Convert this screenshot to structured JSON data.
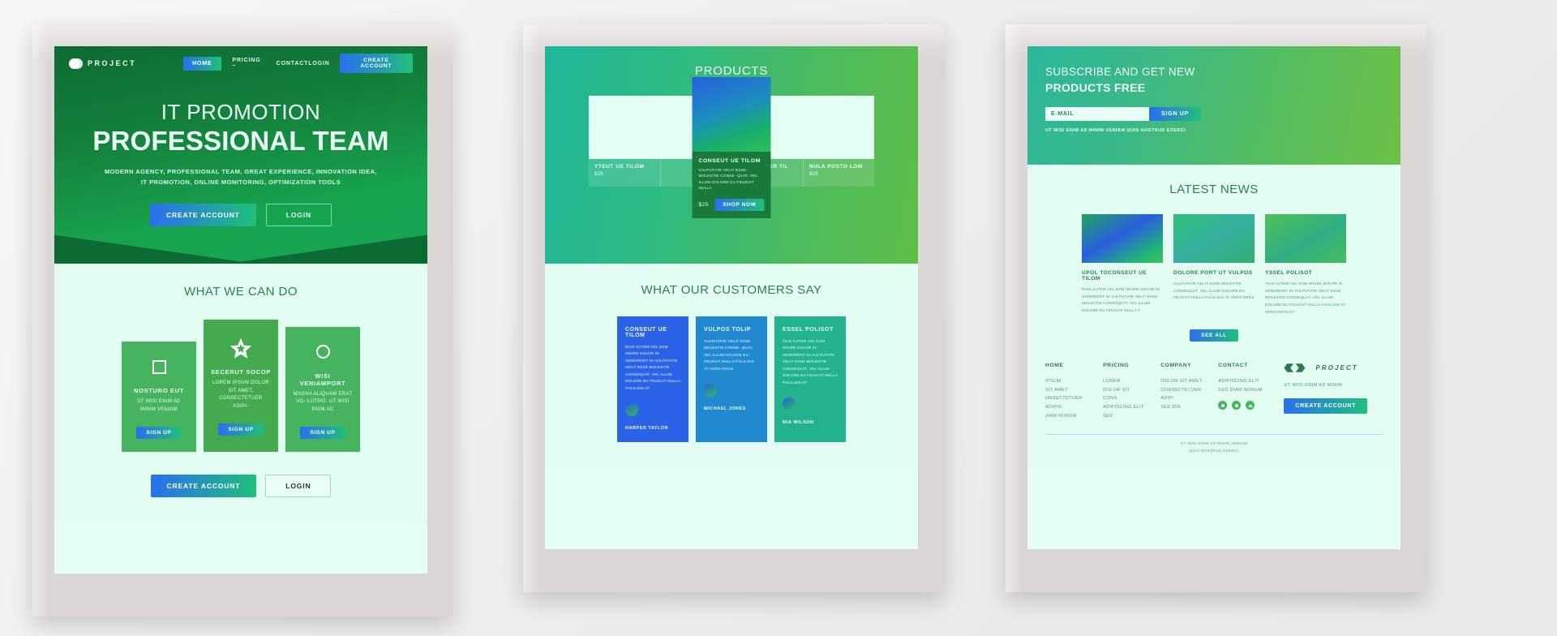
{
  "panel1": {
    "nav": {
      "brand": "PROJECT",
      "links": [
        {
          "label": "HOME",
          "active": true
        },
        {
          "label": "PRICING ~",
          "active": false
        },
        {
          "label": "CONTACT",
          "active": false
        }
      ],
      "login": "LOGIN",
      "create_account": "CREATE ACCOUNT"
    },
    "hero": {
      "eyebrow": "IT PROMOTION",
      "title": "PROFESSIONAL TEAM",
      "desc_line1": "MODERN AGENCY, PROFESSIONAL TEAM, GREAT EXPERIENCE, INNOVATION IDEA,",
      "desc_line2": "IT PROMOTION, ONLINE MONITORING, OPTIMIZATION TOOLS",
      "cta_primary": "CREATE ACCOUNT",
      "cta_secondary": "LOGIN"
    },
    "services": {
      "title": "WHAT WE CAN DO",
      "cards": [
        {
          "icon": "square-icon",
          "title": "NOSTURO EUT",
          "text": "UT WISI ENIM AD MINIM VENIAM",
          "button": "SIGN UP"
        },
        {
          "icon": "star-icon",
          "title": "SECERUT SOCOP",
          "text": "LOREM IPSUM DOLOR SIT AMET, CONSECTETUER ADIPI-",
          "button": "SIGN UP"
        },
        {
          "icon": "circle-icon",
          "title": "WISI VENIAMPORT",
          "text": "MAGNA ALIQUAM ERAT VO- LUTPAT. UT WISI ENIM AD",
          "button": "SIGN UP"
        }
      ],
      "cta_primary": "CREATE ACCOUNT",
      "cta_secondary": "LOGIN"
    }
  },
  "panel2": {
    "products": {
      "title": "PRODUCTS",
      "items": [
        {
          "title": "YTEUT UE TILOM",
          "price": "$25"
        },
        {
          "title": "MOSEUT UER TIL OM",
          "price": "$25"
        },
        {
          "title": "NULA POSTO LOM",
          "price": "$25"
        }
      ],
      "featured": {
        "title": "CONSEUT UE TILOM",
        "text": "VULPUTATE VELIT ESSE MOLESTIE CONSE- QUAT, VEL ILLUM DOLORE EU FEUGIAT NULLA",
        "price": "$25",
        "button": "SHOP NOW"
      }
    },
    "testimonials": {
      "title": "WHAT OUR CUSTOMERS SAY",
      "cards": [
        {
          "title": "CONSEUT UE TILOM",
          "text": "DUIS AUTEM VEL EUM IRIURE DOLOR IN HENDRERIT IN VULPUTATE VELIT ESSE MOLESTIE CONSEQUAT, VEL ILLUM DOLORE EU FEUGIAT NULLA FACILISIS AT",
          "name": "HARPER TAYLOR"
        },
        {
          "title": "VULPOS TOLIP",
          "text": "VULPUTATE VELIT ESSE MOLESTIE CONSE- QUAT, VEL ILLUM DOLORE EU FEUGIAT NULLA FACILISIS AT VERO EROS",
          "name": "MICHAEL JONES"
        },
        {
          "title": "ESSEL POLISOT",
          "text": "TUIS AUTEM VEL EUM IRIURE DOLOR IN HENDRERIT IN VULPUTATE VELIT ESSE MOLESTIE CONSEQUAT, VEL ILLUM DOLORE EU FEUGIAT NULLA FACILISIS AT",
          "name": "MIA WILSON"
        }
      ]
    }
  },
  "panel3": {
    "subscribe": {
      "line1": "SUBSCRIBE AND GET NEW",
      "line2": "PRODUCTS FREE",
      "email_placeholder": "E-MAIL",
      "button": "SIGN UP",
      "note": "UT WISI ENIM AD MINIM VENIAM QUIS NOSTRUD EXERCI"
    },
    "news": {
      "title": "LATEST NEWS",
      "items": [
        {
          "title": "UPOL TOCONSEUT UE TILOM",
          "text": "DUIS AUTEM VEL EUM IRIURE DOLOR IN HENDRERIT IN VULPUTATE VELIT ESSE MOLESTIE CONSEQUAT, VEL ILLUM DOLORE EU FEUGIAT NULLA F"
        },
        {
          "title": "DOLORE PORT UT VULPOS",
          "text": "VULPUTATE VELIT ESSE MOLESTIE CONSEQUAT, VEL ILLUM DOLORE EU FEUGIAT NULLA FACILISIS AT VERO EROS"
        },
        {
          "title": "YSSEL POLISOT",
          "text": "TUIS AUTEM VEL EUM IRIURE DOLOR IN HENDRERIT IN VULPUTATE VELIT ESSE MOLESTIE CONSEQUAT, VEL ILLUM DOLORE EU FEUGIAT NULLA FACILISIS AT VERO EROS ET"
        }
      ],
      "see_all": "SEE ALL"
    },
    "footer": {
      "columns": [
        {
          "heading": "HOME",
          "items": [
            "IPSUM",
            "SIT AMET",
            "HNSECTETUER",
            "ADIPIS",
            "JIAM NONUM"
          ]
        },
        {
          "heading": "PRICING",
          "items": [
            "LOREM",
            "DOLOR SIT",
            "CONS",
            "ADIPISCING ELIT",
            "SED"
          ]
        },
        {
          "heading": "COMPANY",
          "items": [
            "DOLOR SIT AMET",
            "CONSECTETUER",
            "ADIPI",
            "SED DIA"
          ]
        },
        {
          "heading": "CONTACT",
          "items": [
            "ADIPISCING ELIT",
            "SED DIAM NONUM"
          ]
        }
      ],
      "brand": "PROJECT",
      "brand_note": "UT WISI ENIM AD MINIM",
      "cta": "CREATE ACCOUNT",
      "legal_line1": "UT WISI ENIM AD MINIM VENIAM",
      "legal_line2": "QUIS NOSTRUD EXERCI"
    }
  },
  "colors": {
    "accent_blue": "#2a6ff0",
    "accent_green": "#1fc07a",
    "hero_green": "#14803d",
    "light_bg": "#e3fdf3"
  }
}
